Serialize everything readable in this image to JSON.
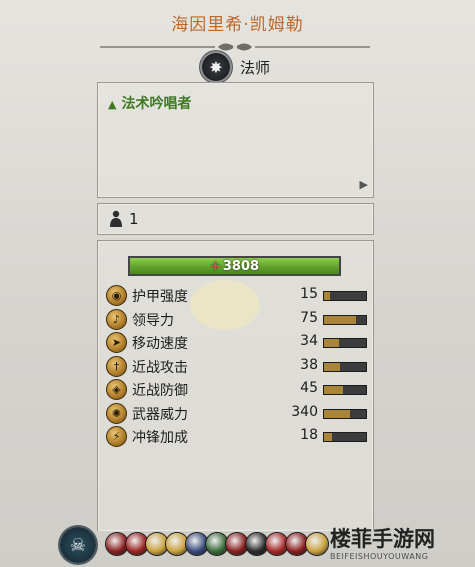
{
  "hero": {
    "name": "海因里希·凯姆勒",
    "class_name": "法师",
    "class_icon": "star-burst-icon"
  },
  "abilities": {
    "items": [
      "法术吟唱者"
    ]
  },
  "unit": {
    "count": "1",
    "icon": "person-icon"
  },
  "health": {
    "value": "3808",
    "fill_fraction": 1.0,
    "bar_color": "#6fb035"
  },
  "stats": [
    {
      "label": "护甲强度",
      "value": "15",
      "fill": 0.15,
      "icon": "shield-icon"
    },
    {
      "label": "领导力",
      "value": "75",
      "fill": 0.75,
      "icon": "horn-icon"
    },
    {
      "label": "移动速度",
      "value": "34",
      "fill": 0.35,
      "icon": "boot-icon"
    },
    {
      "label": "近战攻击",
      "value": "38",
      "fill": 0.38,
      "icon": "sword-icon"
    },
    {
      "label": "近战防御",
      "value": "45",
      "fill": 0.45,
      "icon": "shield-defense-icon"
    },
    {
      "label": "武器威力",
      "value": "340",
      "fill": 0.62,
      "icon": "burst-icon"
    },
    {
      "label": "冲锋加成",
      "value": "18",
      "fill": 0.18,
      "icon": "charge-icon"
    }
  ],
  "bottom": {
    "portrait_icon": "skull-icon",
    "skills": [
      {
        "icon": "red-skill-icon",
        "color": "#8b1f1f"
      },
      {
        "icon": "red-skill-icon",
        "color": "#9c2424"
      },
      {
        "icon": "gold-skill-icon",
        "color": "#c9a23e"
      },
      {
        "icon": "gold-skill-icon",
        "color": "#c9a23e"
      },
      {
        "icon": "blue-skill-icon",
        "color": "#3a4a7c"
      },
      {
        "icon": "green-skill-icon",
        "color": "#3a6b3a"
      },
      {
        "icon": "red-skill-icon",
        "color": "#8b1f1f"
      },
      {
        "icon": "dark-skill-icon",
        "color": "#2b2b2b"
      },
      {
        "icon": "red-skill-icon",
        "color": "#a62828"
      },
      {
        "icon": "red-skill-icon",
        "color": "#8b1f1f"
      },
      {
        "icon": "gold-skill-icon",
        "color": "#c9a23e"
      }
    ]
  },
  "watermark": {
    "title": "楼菲手游网",
    "subtitle": "BEIFEISHOUYOUWANG"
  }
}
